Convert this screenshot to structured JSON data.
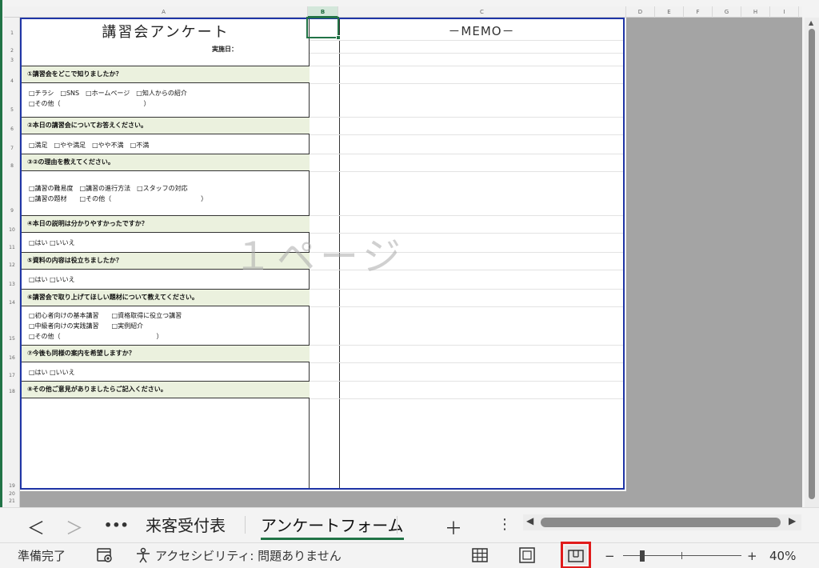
{
  "columns": [
    "A",
    "B",
    "C",
    "D",
    "E",
    "F",
    "G",
    "H",
    "I"
  ],
  "rows": [
    "1",
    "2",
    "3",
    "4",
    "5",
    "6",
    "7",
    "8",
    "9",
    "10",
    "11",
    "12",
    "13",
    "14",
    "15",
    "16",
    "17",
    "18",
    "19",
    "20",
    "21"
  ],
  "sheet": {
    "title": "講習会アンケート",
    "date_label": "実施日：",
    "memo_header": "－MEMO－",
    "watermark": "１ページ",
    "questions": [
      {
        "q": "①講習会をどこで知りましたか？",
        "a": [
          "□チラシ　□SNS　□ホームページ　□知人からの紹介",
          "□その他（　　　　　　　　　　　　　）"
        ]
      },
      {
        "q": "②本日の講習会についてお答えください。",
        "a": [
          "□満足　□やや満足　□やや不満　□不満"
        ]
      },
      {
        "q": "③②の理由を教えてください。",
        "a": [
          "□講習の難易度　□講習の進行方法　□スタッフの対応",
          "□講習の題材　　□その他（　　　　　　　　　　　　　　）"
        ]
      },
      {
        "q": "④本日の説明は分かりやすかったですか？",
        "a": [
          "□はい □いいえ"
        ]
      },
      {
        "q": "⑤資料の内容は役立ちましたか？",
        "a": [
          "□はい □いいえ"
        ]
      },
      {
        "q": "⑥講習会で取り上げてほしい題材について教えてください。",
        "a": [
          "□初心者向けの基本講習　　□資格取得に役立つ講習",
          "□中級者向けの実践講習　　□実例紹介",
          "□その他（　　　　　　　　　　　　　　　）"
        ]
      },
      {
        "q": "⑦今後も同様の案内を希望しますか？",
        "a": [
          "□はい □いいえ"
        ]
      },
      {
        "q": "⑧その他ご意見がありましたらご記入ください。",
        "a": []
      }
    ]
  },
  "tabbar": {
    "prev": "＜",
    "next": "＞",
    "more": "•••",
    "tabs": [
      {
        "label": "来客受付表",
        "active": false
      },
      {
        "label": "アンケートフォーム",
        "active": true
      }
    ],
    "add": "＋",
    "options": "⋮"
  },
  "statusbar": {
    "ready": "準備完了",
    "accessibility": "アクセシビリティ: 問題ありません",
    "zoom_minus": "−",
    "zoom_plus": "+",
    "zoom_level": "40%",
    "zoom_value": 40,
    "active_view": "page-break-preview"
  },
  "colors": {
    "accent": "#217346",
    "page_border": "#1f35a6",
    "question_fill": "#ebf1de",
    "highlight": "#e01b1b"
  }
}
